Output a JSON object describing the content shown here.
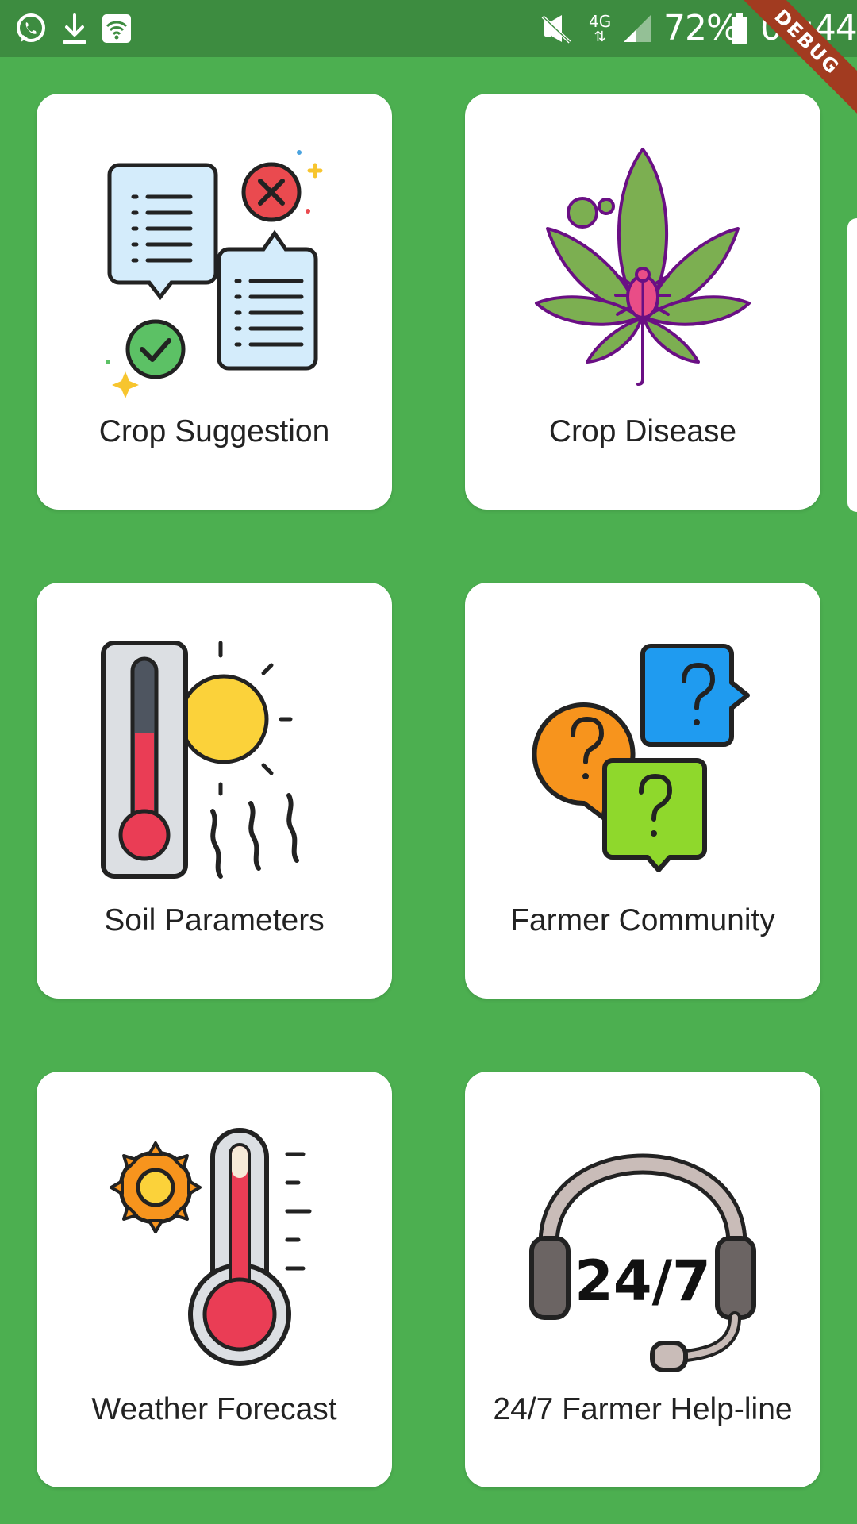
{
  "status_bar": {
    "battery": "72%",
    "time": "09:44",
    "network": "4G",
    "icons": [
      "whatsapp-icon",
      "download-icon",
      "wifi-icon",
      "mute-icon",
      "signal-icon",
      "battery-icon"
    ]
  },
  "debug_banner": "DEBUG",
  "tiles": [
    {
      "label": "Crop Suggestion",
      "icon": "crop-suggestion-icon"
    },
    {
      "label": "Crop Disease",
      "icon": "crop-disease-icon"
    },
    {
      "label": "Soil Parameters",
      "icon": "soil-parameters-icon"
    },
    {
      "label": "Farmer Community",
      "icon": "farmer-community-icon"
    },
    {
      "label": "Weather Forecast",
      "icon": "weather-forecast-icon"
    },
    {
      "label": "24/7 Farmer Help-line",
      "icon": "helpline-icon"
    }
  ],
  "helpline_icon_text": "24/7",
  "colors": {
    "background": "#4caf50",
    "status_bar": "#3d8c40",
    "card": "#ffffff",
    "debug_banner": "#a23b20"
  }
}
